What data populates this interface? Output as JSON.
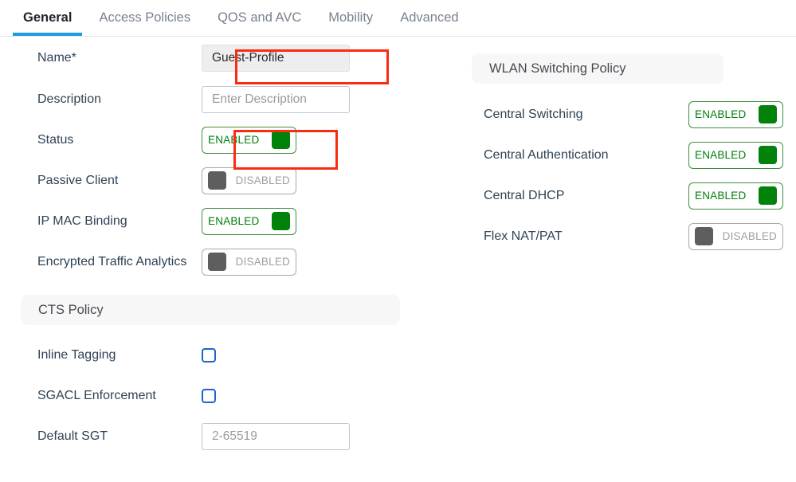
{
  "tabs": [
    {
      "label": "General",
      "active": true
    },
    {
      "label": "Access Policies",
      "active": false
    },
    {
      "label": "QOS and AVC",
      "active": false
    },
    {
      "label": "Mobility",
      "active": false
    },
    {
      "label": "Advanced",
      "active": false
    }
  ],
  "left": {
    "fields": {
      "name": {
        "label": "Name*",
        "value": "Guest-Profile",
        "readonly": true,
        "highlighted": true
      },
      "description": {
        "label": "Description",
        "value": "",
        "placeholder": "Enter Description"
      },
      "status": {
        "label": "Status",
        "state": "ENABLED",
        "highlighted": true
      },
      "passive_client": {
        "label": "Passive Client",
        "state": "DISABLED"
      },
      "ip_mac_binding": {
        "label": "IP MAC Binding",
        "state": "ENABLED"
      },
      "encrypted_traffic_analytics": {
        "label": "Encrypted Traffic Analytics",
        "state": "DISABLED"
      }
    },
    "cts_section": {
      "title": "CTS Policy",
      "inline_tagging": {
        "label": "Inline Tagging",
        "checked": false
      },
      "sgacl_enforcement": {
        "label": "SGACL Enforcement",
        "checked": false
      },
      "default_sgt": {
        "label": "Default SGT",
        "value": "",
        "placeholder": "2-65519"
      }
    }
  },
  "right": {
    "section": {
      "title": "WLAN Switching Policy",
      "central_switching": {
        "label": "Central Switching",
        "state": "ENABLED"
      },
      "central_authentication": {
        "label": "Central Authentication",
        "state": "ENABLED"
      },
      "central_dhcp": {
        "label": "Central DHCP",
        "state": "ENABLED"
      },
      "flex_nat_pat": {
        "label": "Flex NAT/PAT",
        "state": "DISABLED"
      }
    }
  },
  "colors": {
    "accent_blue": "#1e9ae0",
    "enabled_green": "#00820b",
    "disabled_gray": "#5e5e5e",
    "checkbox_blue": "#1f63d0",
    "annotation_red": "#fb2b12"
  }
}
